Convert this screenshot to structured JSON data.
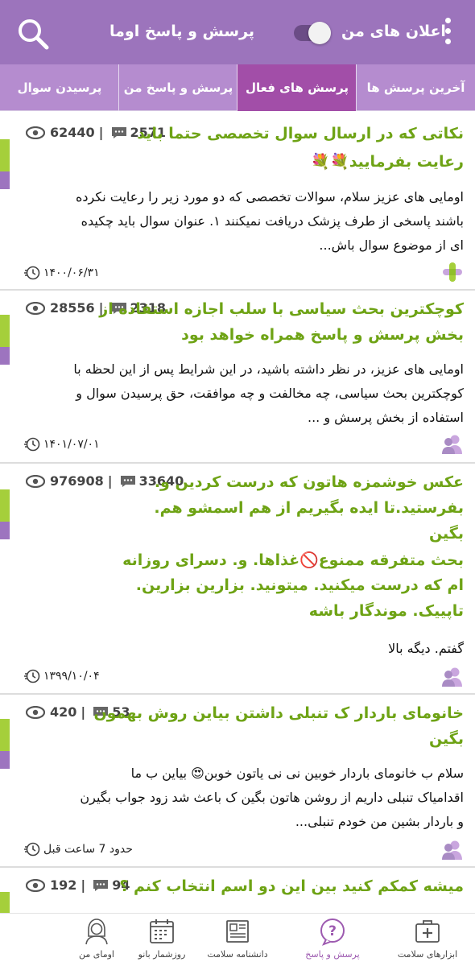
{
  "header": {
    "title": "پرسش و پاسخ اوما",
    "notifications_label": "اعلان های من",
    "notifications_enabled": false,
    "search_icon": "search-icon",
    "menu_icon": "more-vertical-icon"
  },
  "tabs": [
    {
      "label": "آخرین پرسش ها",
      "active": false
    },
    {
      "label": "پرسش های فعال",
      "active": true
    },
    {
      "label": "پرسش و پاسخ من",
      "active": false
    },
    {
      "label": "پرسیدن سوال",
      "active": false
    }
  ],
  "posts": [
    {
      "title_lines": [
        "نکاتی که در ارسال سوال تخصصی حتما باید",
        "رعایت بفرمایید💐💐"
      ],
      "body_lines": [
        "اومایی های عزیز سلام، سوالات تخصصی که دو مورد زیر را رعایت نکرده",
        "باشند پاسخی از طرف پزشک دریافت نمیکنند ۱. عنوان سوال باید چکیده",
        "ای از موضوع سوال باش..."
      ],
      "comments": "2571",
      "views": "62440",
      "date": "۱۴۰۰/۰۶/۳۱",
      "author_icon": "medical-cross-icon"
    },
    {
      "title_lines": [
        "کوچکترین بحث سیاسی با سلب اجازه استفاده از",
        "بخش پرسش و پاسخ همراه خواهد بود"
      ],
      "body_lines": [
        "اومایی های عزیز، در نظر داشته باشید، در این شرایط پس از این لحظه با",
        "کوچکترین بحث سیاسی، چه مخالفت و چه موافقت، حق پرسیدن سوال و",
        "استفاده از بخش پرسش و ..."
      ],
      "comments": "2318",
      "views": "28556",
      "date": "۱۴۰۱/۰۷/۰۱",
      "author_icon": "users-icon"
    },
    {
      "title_lines": [
        "عکس خوشمزه هاتون که درست کردین و.",
        "بفرستید.تا ایده بگیریم از هم اسمشو هم.",
        "بگین",
        "بحث متفرقه ممنوع🚫غذاها. و. دسرای روزانه",
        "ام که درست میکنید. میتونید. بزارین بزارین.",
        "تاپییک. موندگار باشه"
      ],
      "body_lines": [
        "گفتم. دیگه بالا"
      ],
      "comments": "33640",
      "views": "976908",
      "date": "۱۳۹۹/۱۰/۰۴",
      "author_icon": "users-icon"
    },
    {
      "title_lines": [
        "خانومای باردار ک تنبلی داشتن بیاین روش بهمون",
        "بگین"
      ],
      "body_lines": [
        "سلام ب خانومای باردار خوبین نی نی یاتون خوبن😍 بیاین ب ما",
        "اقدامیاک تنبلی داریم از روشن هاتون بگین ک باعث شد زود جواب بگیرن",
        "و باردار بشین من خودم تنبلی..."
      ],
      "comments": "53",
      "views": "420",
      "date": "حدود 7 ساعت قبل",
      "author_icon": "users-icon"
    },
    {
      "title_lines": [
        "میشه کمکم کنید بین این دو اسم انتخاب کنم ؟"
      ],
      "body_lines": [],
      "comments": "94",
      "views": "192",
      "date": "",
      "author_icon": ""
    }
  ],
  "bottom_nav": [
    {
      "label": "ابزارهای سلامت",
      "icon": "medical-kit-icon",
      "active": false
    },
    {
      "label": "پرسش و پاسخ",
      "icon": "question-bubble-icon",
      "active": true
    },
    {
      "label": "دانشنامه سلامت",
      "icon": "encyclopedia-icon",
      "active": false
    },
    {
      "label": "روزشمار بانو",
      "icon": "calendar-icon",
      "active": false
    },
    {
      "label": "اومای من",
      "icon": "woman-avatar-icon",
      "active": false
    }
  ],
  "colors": {
    "header": "#9c74bc",
    "tabs": "#b58ccf",
    "active_tab": "#a24ea8",
    "title_green": "#6ea315",
    "strip_green": "#a5cf3b",
    "strip_purple": "#9d74bf"
  }
}
